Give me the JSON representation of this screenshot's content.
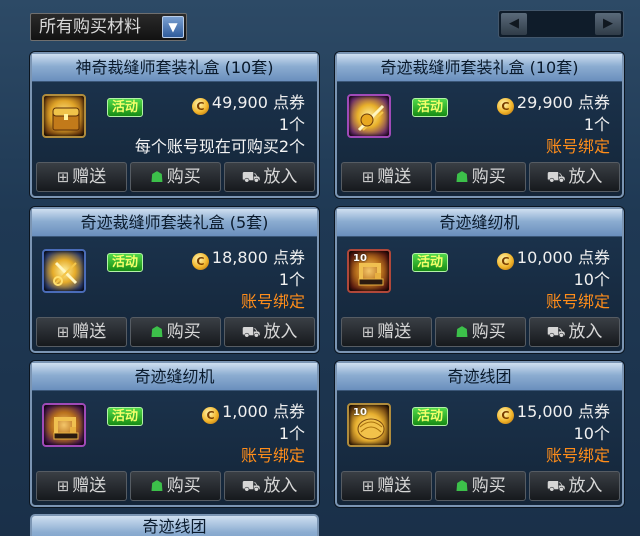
{
  "filter": {
    "selected": "所有购买材料",
    "arrow": "▼"
  },
  "pager": {
    "prev": "◀",
    "next": "▶"
  },
  "badge_label": "活动",
  "actions": {
    "gift": "赠送",
    "buy": "购买",
    "put": "放入"
  },
  "colors": {
    "note_orange": "#ff8d1a",
    "badge_green": "#2fb52a",
    "title_blue": "#8cadd1"
  },
  "items": [
    {
      "title": "神奇裁缝师套装礼盒 (10套)",
      "price": "49,900 点券",
      "qty": "1个",
      "note": "每个账号现在可购买2个",
      "note_style": "white",
      "icon": "treasure-chest-icon"
    },
    {
      "title": "奇迹裁缝师套装礼盒 (10套)",
      "price": "29,900 点券",
      "qty": "1个",
      "note": "账号绑定",
      "note_style": "orange",
      "icon": "golden-thread-box-icon"
    },
    {
      "title": "奇迹裁缝师套装礼盒 (5套)",
      "price": "18,800 点券",
      "qty": "1个",
      "note": "账号绑定",
      "note_style": "orange",
      "icon": "golden-scissors-icon"
    },
    {
      "title": "奇迹缝纫机",
      "price": "10,000 点券",
      "qty": "10个",
      "note": "账号绑定",
      "note_style": "orange",
      "icon": "sewing-machine-icon",
      "count": "10"
    },
    {
      "title": "奇迹缝纫机",
      "price": "1,000 点券",
      "qty": "1个",
      "note": "账号绑定",
      "note_style": "orange",
      "icon": "sewing-machine-icon"
    },
    {
      "title": "奇迹线团",
      "price": "15,000 点券",
      "qty": "10个",
      "note": "账号绑定",
      "note_style": "orange",
      "icon": "yarn-ball-icon",
      "count": "10"
    }
  ],
  "partial_title": "奇迹线团"
}
